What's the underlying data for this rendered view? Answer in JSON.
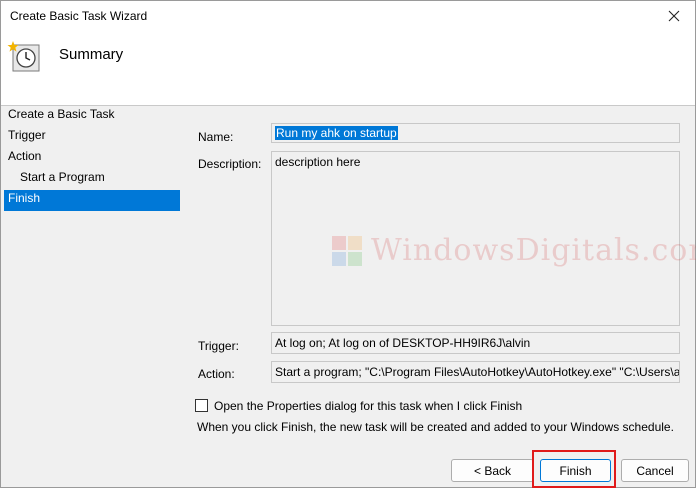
{
  "window": {
    "title": "Create Basic Task Wizard"
  },
  "header": {
    "title": "Summary",
    "icon": "clock-icon"
  },
  "steps": [
    {
      "label": "Create a Basic Task",
      "level": 0,
      "active": false
    },
    {
      "label": "Trigger",
      "level": 0,
      "active": false
    },
    {
      "label": "Action",
      "level": 0,
      "active": false
    },
    {
      "label": "Start a Program",
      "level": 1,
      "active": false
    },
    {
      "label": "Finish",
      "level": 0,
      "active": true
    }
  ],
  "form": {
    "name_label": "Name:",
    "name_value": "Run my ahk on startup",
    "description_label": "Description:",
    "description_value": "description here",
    "trigger_label": "Trigger:",
    "trigger_value": "At log on; At log on of DESKTOP-HH9IR6J\\alvin",
    "action_label": "Action:",
    "action_value": "Start a program; \"C:\\Program Files\\AutoHotkey\\AutoHotkey.exe\" \"C:\\Users\\alvin"
  },
  "open_properties": {
    "label": "Open the Properties dialog for this task when I click Finish",
    "checked": false
  },
  "info_text": "When you click Finish, the new task will be created and added to your Windows schedule.",
  "buttons": {
    "back": "< Back",
    "finish": "Finish",
    "cancel": "Cancel"
  },
  "watermark": "WindowsDigitals.com",
  "colors": {
    "selection": "#0078d7",
    "highlight_box": "#e01a1a"
  }
}
